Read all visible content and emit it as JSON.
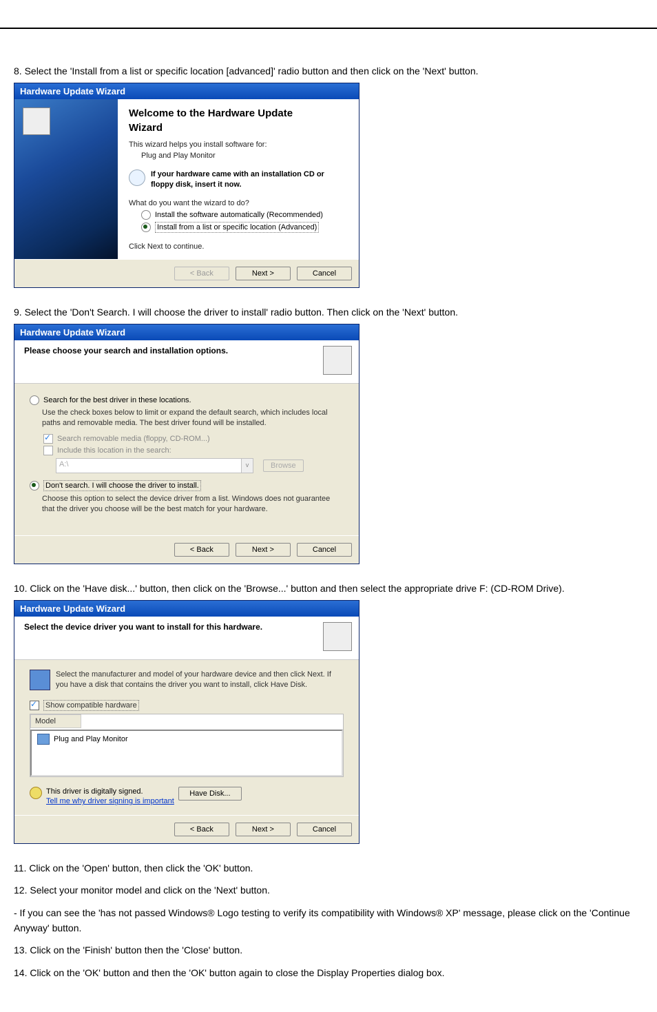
{
  "steps": {
    "s8": "8. Select the 'Install from a list or specific location [advanced]' radio button and then click on the 'Next' button.",
    "s9": "9. Select the 'Don't Search. I will choose the driver to install' radio button. Then click on the 'Next' button.",
    "s10": "10. Click on the 'Have disk...' button, then click on the 'Browse...' button and then select the appropriate drive F: (CD-ROM Drive).",
    "s11": "11. Click on the 'Open' button, then click the 'OK' button.",
    "s12": "12. Select your monitor model and click on the 'Next' button.",
    "s12b": "- If you can see the 'has not passed Windows® Logo testing to verify its compatibility with Windows® XP' message, please click on the 'Continue Anyway' button.",
    "s13": "13. Click on the 'Finish' button then the 'Close' button.",
    "s14": "14. Click on the 'OK' button and then the 'OK' button again to close the Display Properties dialog box."
  },
  "dlg1": {
    "title": "Hardware Update Wizard",
    "welcome": "Welcome to the Hardware Update",
    "wizard": "Wizard",
    "helps": "This wizard helps you install software for:",
    "device": "Plug and Play Monitor",
    "note": "If your hardware came with an installation CD or floppy disk, insert it now.",
    "what": "What do you want the wizard to do?",
    "r1": "Install the software automatically (Recommended)",
    "r2": "Install from a list or specific location (Advanced)",
    "cont": "Click Next to continue.",
    "back": "< Back",
    "next": "Next >",
    "cancel": "Cancel"
  },
  "dlg2": {
    "title": "Hardware Update Wizard",
    "header": "Please choose your search and installation options.",
    "r1": "Search for the best driver in these locations.",
    "r1sub": "Use the check boxes below to limit or expand the default search, which includes local paths and removable media. The best driver found will be installed.",
    "c1": "Search removable media (floppy, CD-ROM...)",
    "c2": "Include this location in the search:",
    "path": "A:\\",
    "browse": "Browse",
    "r2": "Don't search. I will choose the driver to install.",
    "r2sub": "Choose this option to select the device driver from a list.  Windows does not guarantee that the driver you choose will be the best match for your hardware.",
    "back": "< Back",
    "next": "Next >",
    "cancel": "Cancel"
  },
  "dlg3": {
    "title": "Hardware Update Wizard",
    "header": "Select the device driver you want to install for this hardware.",
    "sub": "Select the manufacturer and model of your hardware device and then click Next. If you have a disk that contains the driver you want to install, click Have Disk.",
    "showcompat": "Show compatible hardware",
    "col": "Model",
    "item": "Plug and Play Monitor",
    "signed": "This driver is digitally signed.",
    "tell": "Tell me why driver signing is important",
    "have": "Have Disk...",
    "back": "< Back",
    "next": "Next >",
    "cancel": "Cancel"
  }
}
